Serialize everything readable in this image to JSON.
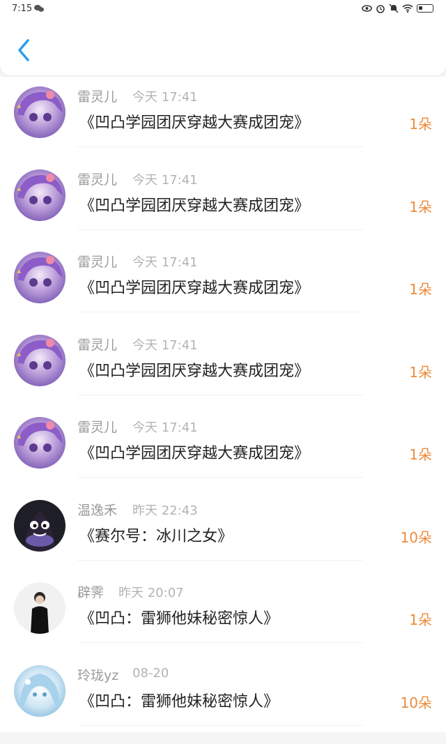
{
  "status": {
    "time": "7:15",
    "icons": [
      "eye-icon",
      "alarm-icon",
      "mute-icon",
      "wifi-icon",
      "battery-icon"
    ]
  },
  "header": {
    "back_icon": "chevron-left-icon",
    "accent": "#2b9cf2"
  },
  "colors": {
    "amount": "#ec8b3b",
    "name": "#9a9a9a",
    "time": "#b3b3b3"
  },
  "items": [
    {
      "name": "雷灵儿",
      "time": "今天 17:41",
      "title": "《凹凸学园团厌穿越大赛成团宠》",
      "amount": "1朵",
      "avatar": "anime-purple-avatar"
    },
    {
      "name": "雷灵儿",
      "time": "今天 17:41",
      "title": "《凹凸学园团厌穿越大赛成团宠》",
      "amount": "1朵",
      "avatar": "anime-purple-avatar"
    },
    {
      "name": "雷灵儿",
      "time": "今天 17:41",
      "title": "《凹凸学园团厌穿越大赛成团宠》",
      "amount": "1朵",
      "avatar": "anime-purple-avatar"
    },
    {
      "name": "雷灵儿",
      "time": "今天 17:41",
      "title": "《凹凸学园团厌穿越大赛成团宠》",
      "amount": "1朵",
      "avatar": "anime-purple-avatar"
    },
    {
      "name": "雷灵儿",
      "time": "今天 17:41",
      "title": "《凹凸学园团厌穿越大赛成团宠》",
      "amount": "1朵",
      "avatar": "anime-purple-avatar"
    },
    {
      "name": "温逸禾",
      "time": "昨天 22:43",
      "title": "《赛尔号：冰川之女》",
      "amount": "10朵",
      "avatar": "dark-cartoon-avatar"
    },
    {
      "name": "辟霁",
      "time": "昨天 20:07",
      "title": "《凹凸：雷狮他妹秘密惊人》",
      "amount": "1朵",
      "avatar": "person-photo-avatar"
    },
    {
      "name": "玲珑yz",
      "time": "08-20",
      "title": "《凹凸：雷狮他妹秘密惊人》",
      "amount": "10朵",
      "avatar": "anime-blue-avatar"
    }
  ]
}
